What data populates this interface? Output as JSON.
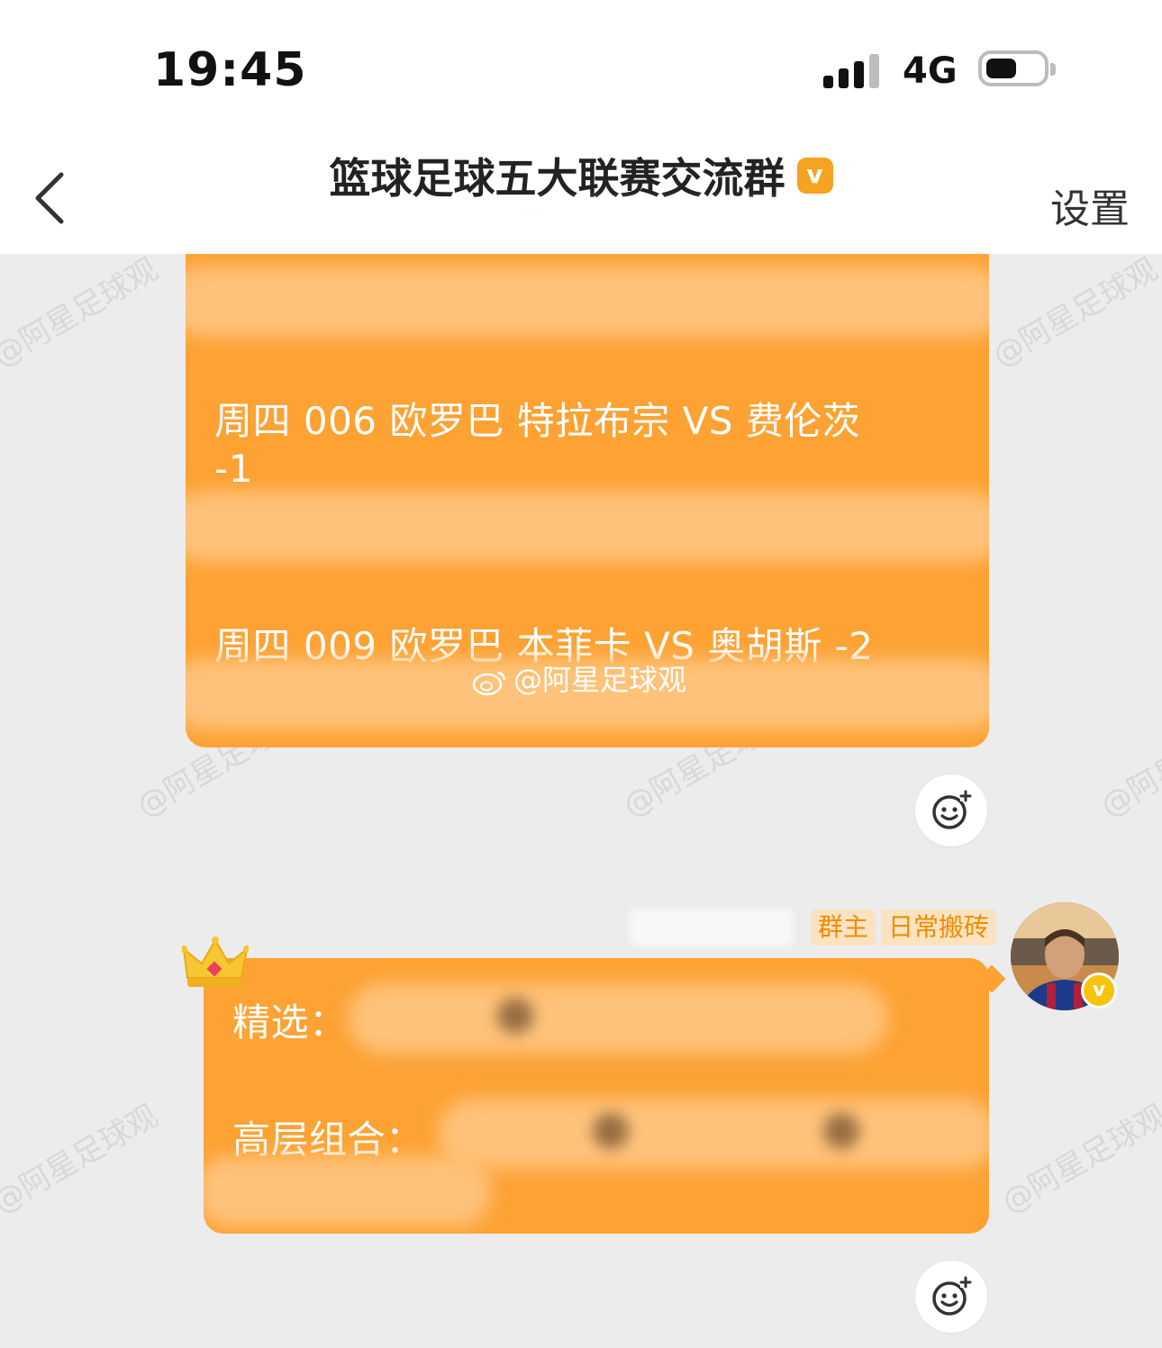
{
  "status_bar": {
    "time": "19:45",
    "network": "4G",
    "battery_level": 0.55
  },
  "header": {
    "title": "篮球足球五大联赛交流群",
    "settings_label": "设置"
  },
  "messages": {
    "bubble1": {
      "line_a1": "周四 006 欧罗巴 特拉布宗 VS 费伦茨",
      "line_a2": "-1",
      "line_b1": "周四 009 欧罗巴 本菲卡 VS 奥胡斯 -2"
    },
    "watermark": "@阿星足球观",
    "faint_watermark": "@阿星足球观",
    "sender": {
      "role_tag": "群主",
      "title_tag": "日常搬砖"
    },
    "bubble2": {
      "label_pick": "精选：",
      "label_combo": "高层组合："
    }
  },
  "colors": {
    "bubble": "#fda233",
    "tag_bg": "#fbe2c0",
    "tag_text": "#f08c00",
    "background": "#ececec"
  },
  "icons": [
    "back-chevron-icon",
    "verified-badge-icon",
    "reaction-add-icon",
    "crown-icon",
    "weibo-logo-icon"
  ]
}
